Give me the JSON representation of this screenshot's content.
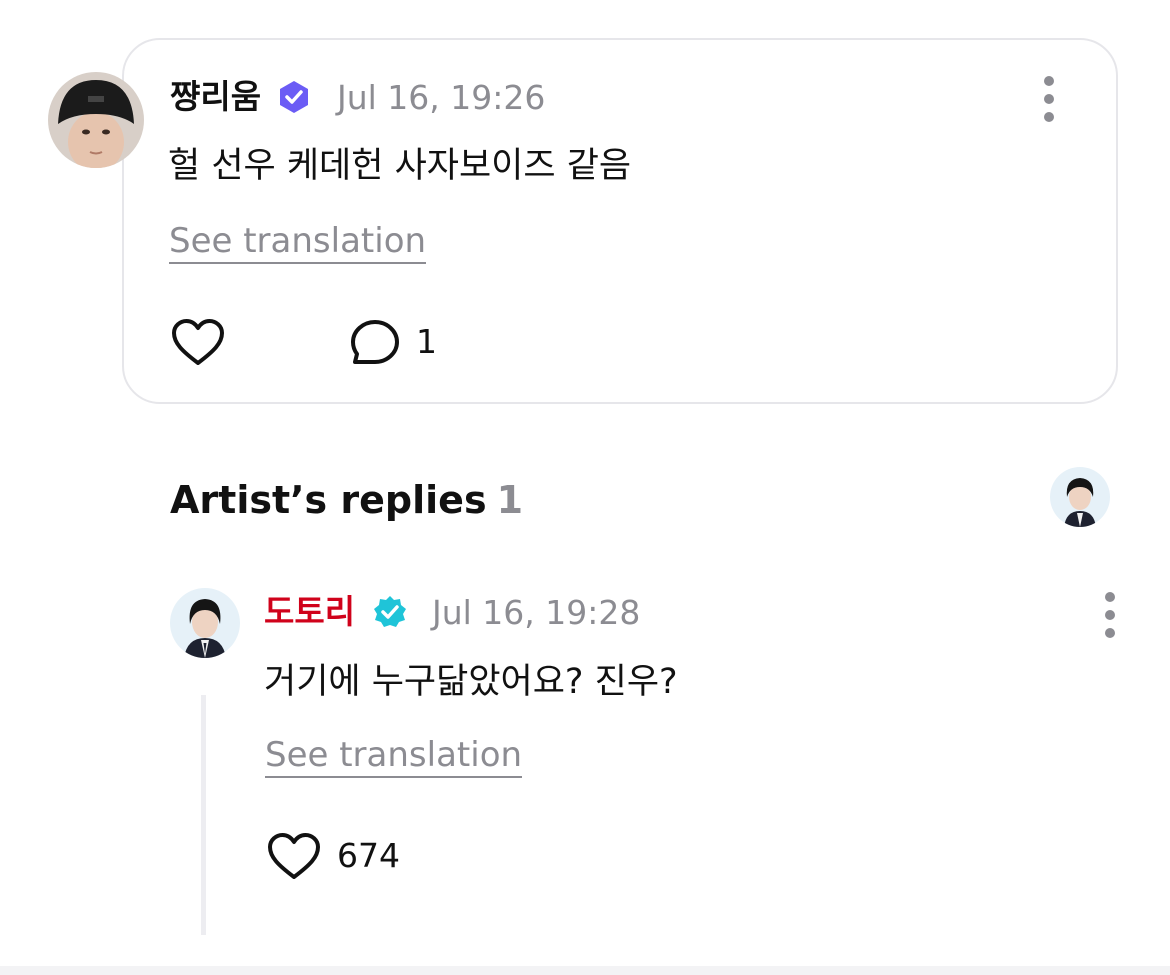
{
  "comment": {
    "username": "쨩리움",
    "timestamp": "Jul 16, 19:26",
    "text": "헐 선우 케데헌 사자보이즈 같음",
    "see_translation": "See translation",
    "reply_count": "1"
  },
  "artist_replies": {
    "title": "Artist’s replies",
    "count": "1"
  },
  "reply": {
    "username": "도토리",
    "timestamp": "Jul 16, 19:28",
    "text": "거기에 누구닮았어요? 진우?",
    "see_translation": "See translation",
    "like_count": "674"
  },
  "colors": {
    "artist_name": "#d0021b",
    "fan_badge": "#6b5cf5",
    "artist_badge": "#1fc4d8",
    "muted_text": "#8c8c92",
    "card_border": "#e6e6ea"
  },
  "icons": {
    "fan_badge": "fan-verified-badge-icon",
    "artist_badge": "artist-verified-badge-icon",
    "like": "heart-icon",
    "reply": "speech-bubble-icon",
    "more": "more-vertical-icon"
  }
}
